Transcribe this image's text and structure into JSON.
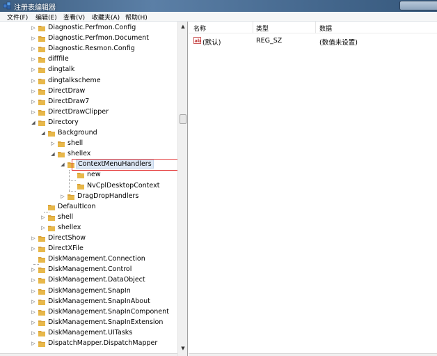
{
  "window": {
    "title": "注册表编辑器"
  },
  "menu": [
    "文件(F)",
    "编辑(E)",
    "查看(V)",
    "收藏夹(A)",
    "帮助(H)"
  ],
  "tree": [
    {
      "label": "Diagnostic.Perfmon.Config",
      "depth": 0,
      "expander": "▷"
    },
    {
      "label": "Diagnostic.Perfmon.Document",
      "depth": 0,
      "expander": "▷"
    },
    {
      "label": "Diagnostic.Resmon.Config",
      "depth": 0,
      "expander": "▷"
    },
    {
      "label": "difffile",
      "depth": 0,
      "expander": "▷"
    },
    {
      "label": "dingtalk",
      "depth": 0,
      "expander": "▷"
    },
    {
      "label": "dingtalkscheme",
      "depth": 0,
      "expander": "▷"
    },
    {
      "label": "DirectDraw",
      "depth": 0,
      "expander": "▷"
    },
    {
      "label": "DirectDraw7",
      "depth": 0,
      "expander": "▷"
    },
    {
      "label": "DirectDrawClipper",
      "depth": 0,
      "expander": "▷"
    },
    {
      "label": "Directory",
      "depth": 0,
      "expander": "◢"
    },
    {
      "label": "Background",
      "depth": 1,
      "expander": "◢"
    },
    {
      "label": "shell",
      "depth": 2,
      "expander": "▷"
    },
    {
      "label": "shellex",
      "depth": 2,
      "expander": "◢"
    },
    {
      "label": "ContextMenuHandlers",
      "depth": 3,
      "expander": "◢",
      "selected": true
    },
    {
      "label": "new",
      "depth": 4,
      "expander": ""
    },
    {
      "label": "NvCplDesktopContext",
      "depth": 4,
      "expander": ""
    },
    {
      "label": "DragDropHandlers",
      "depth": 3,
      "expander": "▷"
    },
    {
      "label": "DefaultIcon",
      "depth": 1,
      "expander": ""
    },
    {
      "label": "shell",
      "depth": 1,
      "expander": "▷"
    },
    {
      "label": "shellex",
      "depth": 1,
      "expander": "▷"
    },
    {
      "label": "DirectShow",
      "depth": 0,
      "expander": "▷"
    },
    {
      "label": "DirectXFile",
      "depth": 0,
      "expander": "▷"
    },
    {
      "label": "DiskManagement.Connection",
      "depth": 0,
      "expander": ""
    },
    {
      "label": "DiskManagement.Control",
      "depth": 0,
      "expander": "▷"
    },
    {
      "label": "DiskManagement.DataObject",
      "depth": 0,
      "expander": "▷"
    },
    {
      "label": "DiskManagement.SnapIn",
      "depth": 0,
      "expander": "▷"
    },
    {
      "label": "DiskManagement.SnapInAbout",
      "depth": 0,
      "expander": "▷"
    },
    {
      "label": "DiskManagement.SnapInComponent",
      "depth": 0,
      "expander": "▷"
    },
    {
      "label": "DiskManagement.SnapInExtension",
      "depth": 0,
      "expander": "▷"
    },
    {
      "label": "DiskManagement.UITasks",
      "depth": 0,
      "expander": "▷"
    },
    {
      "label": "DispatchMapper.DispatchMapper",
      "depth": 0,
      "expander": "▷"
    }
  ],
  "list": {
    "columns": [
      "名称",
      "类型",
      "数据"
    ],
    "rows": [
      {
        "name": "(默认)",
        "type": "REG_SZ",
        "data": "(数值未设置)",
        "icon": "ab-string-icon"
      }
    ]
  },
  "colors": {
    "selection": "#dce7f5",
    "highlight_border": "#e53a3a",
    "folder": "#e8b84a"
  }
}
